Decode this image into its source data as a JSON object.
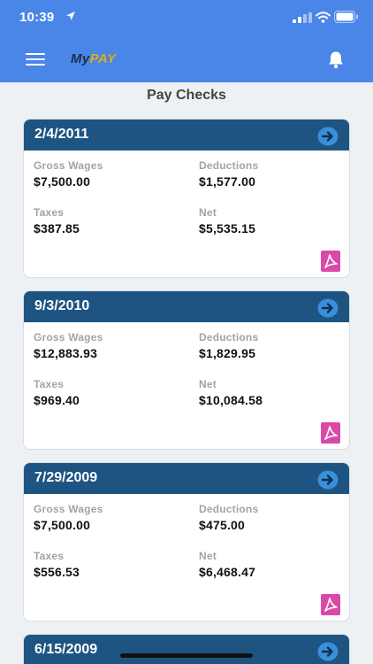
{
  "status_bar": {
    "time": "10:39"
  },
  "app": {
    "logo_my": "My",
    "logo_pay": "PAY"
  },
  "page": {
    "title": "Pay Checks"
  },
  "labels": {
    "gross": "Gross Wages",
    "deductions": "Deductions",
    "taxes": "Taxes",
    "net": "Net"
  },
  "paychecks": [
    {
      "date": "2/4/2011",
      "gross": "$7,500.00",
      "deductions": "$1,577.00",
      "taxes": "$387.85",
      "net": "$5,535.15"
    },
    {
      "date": "9/3/2010",
      "gross": "$12,883.93",
      "deductions": "$1,829.95",
      "taxes": "$969.40",
      "net": "$10,084.58"
    },
    {
      "date": "7/29/2009",
      "gross": "$7,500.00",
      "deductions": "$475.00",
      "taxes": "$556.53",
      "net": "$6,468.47"
    },
    {
      "date": "6/15/2009"
    }
  ],
  "icons": {
    "menu": "hamburger-menu-icon",
    "bell": "bell-icon",
    "arrow": "arrow-right-circle-icon",
    "pdf": "pdf-icon"
  },
  "colors": {
    "header": "#4a86e8",
    "card_header": "#1e5482",
    "arrow": "#3a8fd9",
    "pdf": "#d94aa8",
    "background": "#eef1f4"
  }
}
